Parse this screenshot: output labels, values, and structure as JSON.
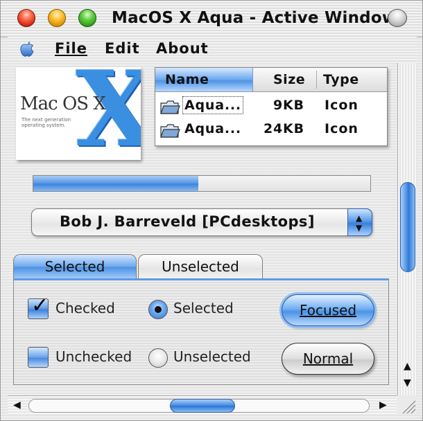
{
  "window": {
    "title": "MacOS X Aqua - Active Window"
  },
  "menu": {
    "file": "File",
    "edit": "Edit",
    "about": "About"
  },
  "logo": {
    "brand": "Mac OS X",
    "tagline": "The next generation operating system.",
    "mark": "X"
  },
  "file_list": {
    "columns": {
      "name": "Name",
      "size": "Size",
      "type": "Type"
    },
    "rows": [
      {
        "name": "Aqua...",
        "size": "9KB",
        "type": "Icon"
      },
      {
        "name": "Aqua...",
        "size": "24KB",
        "type": "Icon"
      }
    ]
  },
  "progress": {
    "fraction": 0.49
  },
  "popup": {
    "selected": "Bob J. Barreveld [PCdesktops]"
  },
  "tabs": {
    "selected": "Selected",
    "unselected": "Unselected"
  },
  "controls": {
    "checkbox_checked": "Checked",
    "checkbox_unchecked": "Unchecked",
    "radio_selected": "Selected",
    "radio_unselected": "Unselected",
    "button_focused": "Focused",
    "button_normal": "Normal"
  },
  "icons": {
    "close": "close-light-icon",
    "minimize": "minimize-light-icon",
    "zoom": "zoom-light-icon",
    "collapse": "collapse-pill-icon",
    "apple": "apple-menu-icon",
    "folder": "folder-icon"
  },
  "colors": {
    "aqua_blue": "#4f93e4",
    "close_red": "#ff6a4a",
    "minimize_yellow": "#ffc43a",
    "zoom_green": "#6ad04a"
  }
}
